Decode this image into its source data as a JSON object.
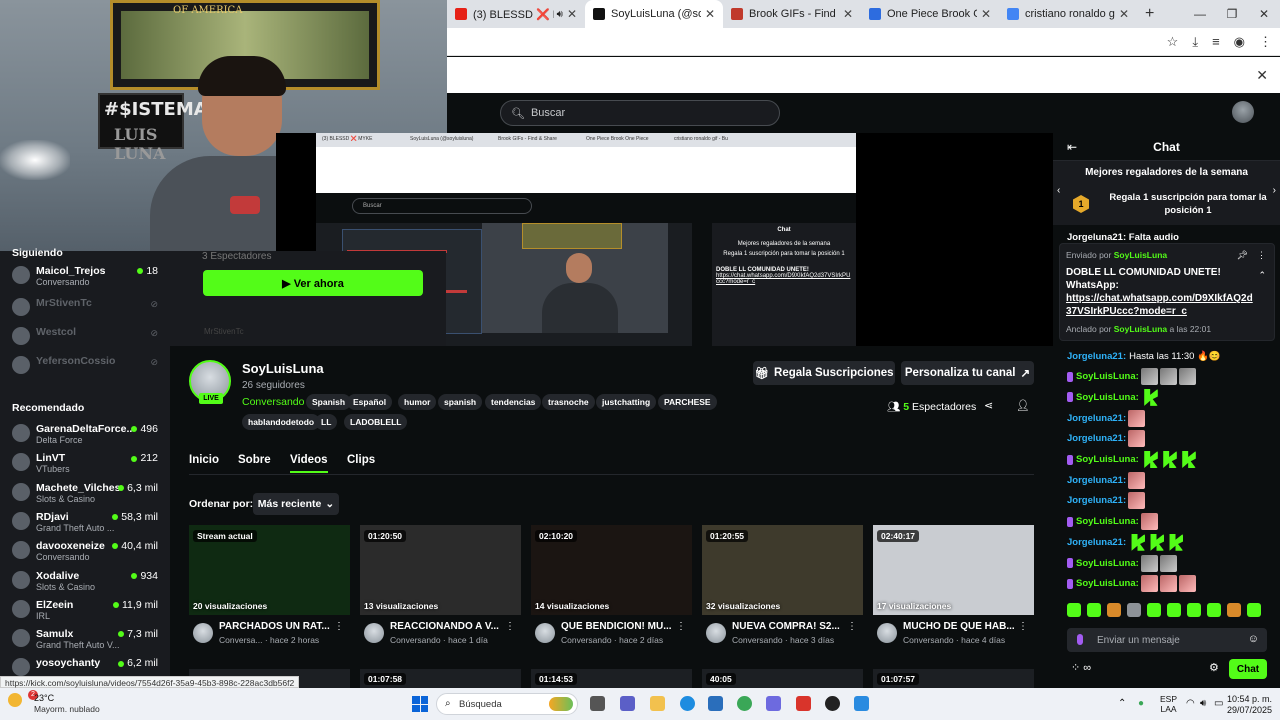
{
  "browser": {
    "tabs": [
      {
        "title": "(3) BLESSD ❌ MYKE",
        "icon_color": "#e62117",
        "has_audio": true
      },
      {
        "title": "SoyLuisLuna (@soyluisluna)",
        "icon_color": "#111111"
      },
      {
        "title": "Brook GIFs - Find & Share",
        "icon_color": "#c0392b"
      },
      {
        "title": "One Piece Brook One Piece",
        "icon_color": "#2d6cdf"
      },
      {
        "title": "cristiano ronaldo gif - Bu",
        "icon_color": "#4285f4"
      }
    ],
    "new_tab": "+",
    "window_controls": [
      "—",
      "❐",
      "✕"
    ],
    "toolbar_icons": [
      "star-icon",
      "download-icon",
      "tab-search-icon",
      "profile-icon",
      "menu-icon"
    ],
    "infobar_close": "✕"
  },
  "kick": {
    "search_placeholder": "Buscar",
    "accent": "#53fc18"
  },
  "webcam": {
    "frame_text": "OF AMERICA",
    "sign_line1": "#$ISTEMA",
    "sign_line2": "LUIS LUNA"
  },
  "sidebar": {
    "following_heading": "Siguiendo",
    "following": [
      {
        "name": "Maicol_Trejos",
        "category": "Conversando",
        "viewers": "18",
        "online": true
      },
      {
        "name": "MrStivenTc",
        "category": "",
        "viewers": "",
        "online": false
      },
      {
        "name": "Westcol",
        "category": "",
        "viewers": "",
        "online": false
      },
      {
        "name": "YefersonCossio",
        "category": "",
        "viewers": "",
        "online": false
      }
    ],
    "recommended_heading": "Recomendado",
    "recommended": [
      {
        "name": "GarenaDeltaForce...",
        "category": "Delta Force",
        "viewers": "496"
      },
      {
        "name": "LinVT",
        "category": "VTubers",
        "viewers": "212"
      },
      {
        "name": "Machete_Vilches",
        "category": "Slots & Casino",
        "viewers": "6,3 mil"
      },
      {
        "name": "RDjavi",
        "category": "Grand Theft Auto ...",
        "viewers": "58,3 mil"
      },
      {
        "name": "davooxeneize",
        "category": "Conversando",
        "viewers": "40,4 mil"
      },
      {
        "name": "Xodalive",
        "category": "Slots & Casino",
        "viewers": "934"
      },
      {
        "name": "ElZeein",
        "category": "IRL",
        "viewers": "11,9 mil"
      },
      {
        "name": "Samulx",
        "category": "Grand Theft Auto V...",
        "viewers": "7,3 mil"
      },
      {
        "name": "yosoychanty",
        "category": "",
        "viewers": "6,2 mil"
      }
    ]
  },
  "offline_card": {
    "viewers_text": "3 Espectadores",
    "watch_button": "▶  Ver ahora",
    "mini_name": "MrStivenTc"
  },
  "nested_preview": {
    "tabs": [
      "(3) BLESSD ❌ MYKE",
      "SoyLuisLuna (@soyluisluna)",
      "Brook GIFs - Find & Share",
      "One Piece Brook One Piece",
      "cristiano ronaldo gif - Bu"
    ],
    "search": "Buscar",
    "chat_title": "Chat",
    "gifters_title": "Mejores regaladores de la semana",
    "gifters_text": "Regala 1 suscripción para tomar la posición 1",
    "pinned_msg": "DOBLE LL COMUNIDAD UNETE!",
    "pinned_link": "https://chat.whatsapp.com/D9XIkfAQ2d37VSIrkPUccc?mode=r_c"
  },
  "channel": {
    "name": "SoyLuisLuna",
    "followers": "26 seguidores",
    "live": "LIVE",
    "category": "Conversando",
    "tags": [
      "Spanish",
      "Español",
      "humor",
      "spanish",
      "tendencias",
      "trasnoche",
      "justchatting",
      "PARCHESE",
      "hablandodetodo",
      "LL",
      "LADOBLELL"
    ],
    "subscribe_button": "Regala Suscripciones",
    "customize_button": "Personaliza tu canal",
    "viewers_count": "5",
    "viewers_label": "Espectadores"
  },
  "nav": {
    "tabs": [
      "Inicio",
      "Sobre",
      "Videos",
      "Clips"
    ],
    "active": "Videos"
  },
  "sort": {
    "label": "Ordenar por:",
    "value": "Más reciente"
  },
  "videos": [
    {
      "duration": "Stream actual",
      "views": "20 visualizaciones",
      "title": "PARCHADOS UN RAT...",
      "category": "Conversa...",
      "ago": "hace 2 horas",
      "thumb": "#0f2a12"
    },
    {
      "duration": "01:20:50",
      "views": "13 visualizaciones",
      "title": "REACCIONANDO A V...",
      "category": "Conversando",
      "ago": "hace 1 día",
      "thumb": "#2b2b2b"
    },
    {
      "duration": "02:10:20",
      "views": "14 visualizaciones",
      "title": "QUE BENDICION! MU...",
      "category": "Conversando",
      "ago": "hace 2 días",
      "thumb": "#1b1512"
    },
    {
      "duration": "01:20:55",
      "views": "32 visualizaciones",
      "title": "NUEVA COMPRA! S2...",
      "category": "Conversando",
      "ago": "hace 3 días",
      "thumb": "#3e3a2c"
    },
    {
      "duration": "02:40:17",
      "views": "17 visualizaciones",
      "title": "MUCHO DE QUE HAB...",
      "category": "Conversando",
      "ago": "hace 4 días",
      "thumb": "#c9ccd1"
    }
  ],
  "videos_row2": [
    {
      "duration": ""
    },
    {
      "duration": "01:07:58"
    },
    {
      "duration": "01:14:53"
    },
    {
      "duration": "40:05"
    },
    {
      "duration": "01:07:57"
    }
  ],
  "chat": {
    "title": "Chat",
    "gifters_heading": "Mejores regaladores de la semana",
    "gifters_rank": "1",
    "gifters_text": "Regala 1 suscripción para tomar la posición 1",
    "peek_line": "Jorgeluna21: Falta audio",
    "pinned": {
      "sent_by_label": "Enviado por",
      "sent_by": "SoyLuisLuna",
      "message": "DOBLE LL COMUNIDAD UNETE! WhatsApp:",
      "link": "https://chat.whatsapp.com/D9XIkfAQ2d37VSIrkPUccc?mode=r_c",
      "pinned_by_label": "Anclado por",
      "pinned_by": "SoyLuisLuna",
      "pinned_time": "a las 22:01"
    },
    "messages": [
      {
        "user": "Jorgeluna21:",
        "text": "Hasta las 11:30 🔥😊",
        "color": "blue",
        "emotes": []
      },
      {
        "user": "SoyLuisLuna:",
        "text": "",
        "color": "green",
        "emotes": [
          "face",
          "face",
          "face"
        ]
      },
      {
        "user": "SoyLuisLuna:",
        "text": "",
        "color": "green",
        "emotes": [
          "kick"
        ]
      },
      {
        "user": "Jorgeluna21:",
        "text": "",
        "color": "blue",
        "emotes": [
          "pink"
        ]
      },
      {
        "user": "Jorgeluna21:",
        "text": "",
        "color": "blue",
        "emotes": [
          "pink"
        ]
      },
      {
        "user": "SoyLuisLuna:",
        "text": "",
        "color": "green",
        "emotes": [
          "kick",
          "kick",
          "kick"
        ]
      },
      {
        "user": "Jorgeluna21:",
        "text": "",
        "color": "blue",
        "emotes": [
          "pink"
        ]
      },
      {
        "user": "Jorgeluna21:",
        "text": "",
        "color": "blue",
        "emotes": [
          "pink"
        ]
      },
      {
        "user": "SoyLuisLuna:",
        "text": "",
        "color": "green",
        "emotes": [
          "pink"
        ]
      },
      {
        "user": "Jorgeluna21:",
        "text": "",
        "color": "blue",
        "emotes": [
          "kick",
          "kick",
          "kick"
        ]
      },
      {
        "user": "SoyLuisLuna:",
        "text": "",
        "color": "green",
        "emotes": [
          "face",
          "face"
        ]
      },
      {
        "user": "SoyLuisLuna:",
        "text": "",
        "color": "green",
        "emotes": [
          "pink",
          "pink",
          "pink"
        ]
      }
    ],
    "input_placeholder": "Enviar un mensaje",
    "send_button": "Chat"
  },
  "status_url": "https://kick.com/soyluisluna/videos/7554d26f-35a9-45b3-898c-228ac3db56f2",
  "taskbar": {
    "weather_temp": "23°C",
    "weather_desc": "Mayorm. nublado",
    "weather_badge": "2",
    "search": "Búsqueda",
    "lang1": "ESP",
    "lang2": "LAA",
    "time": "10:54 p. m.",
    "date": "29/07/2025"
  }
}
